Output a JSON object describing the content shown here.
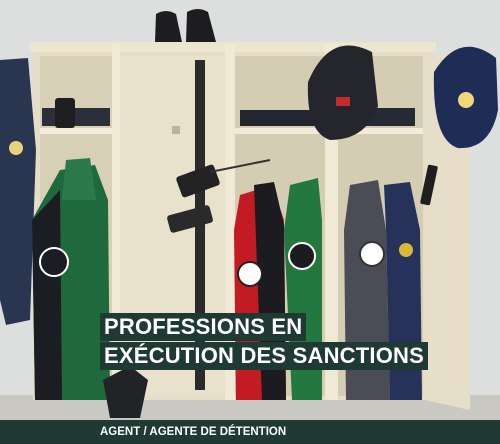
{
  "headline": {
    "line1": "PROFESSIONS EN",
    "line2": "EXÉCUTION DES SANCTIONS"
  },
  "footer": {
    "label": "AGENT / AGENTE DE DÉTENTION"
  },
  "colors": {
    "banner_bg": "#1e3a33",
    "banner_text": "#ffffff",
    "locker": "#e4dcc4",
    "wall": "#d9dcda"
  }
}
